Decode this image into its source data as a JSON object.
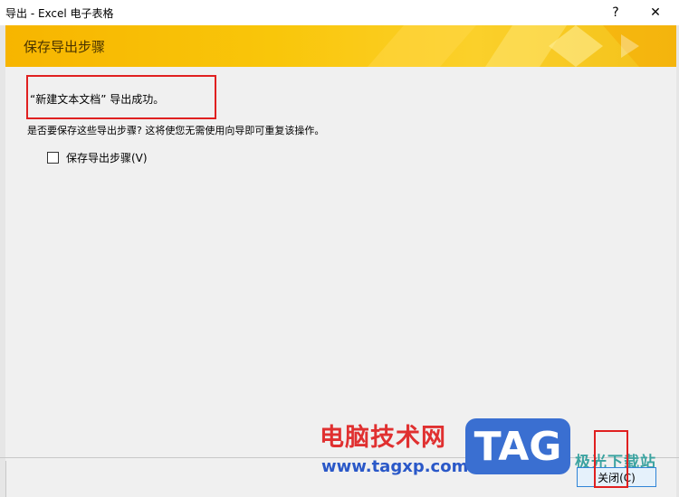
{
  "window": {
    "title": "导出 - Excel 电子表格",
    "help_label": "?",
    "close_label": "✕"
  },
  "banner": {
    "title": "保存导出步骤"
  },
  "content": {
    "success_message": "“新建文本文档” 导出成功。",
    "question": "是否要保存这些导出步骤? 这将使您无需使用向导即可重复该操作。",
    "save_steps_checkbox": {
      "label": "保存导出步骤(V)",
      "checked": false
    }
  },
  "footer": {
    "close_button": "关闭(C)"
  },
  "watermark": {
    "text": "电脑技术网",
    "url": "www.tagxp.com",
    "tag": "TAG",
    "site": "极光下载站"
  },
  "colors": {
    "banner_yellow": "#f9c60a",
    "highlight_red": "#e02020",
    "button_border": "#2f84d6"
  }
}
